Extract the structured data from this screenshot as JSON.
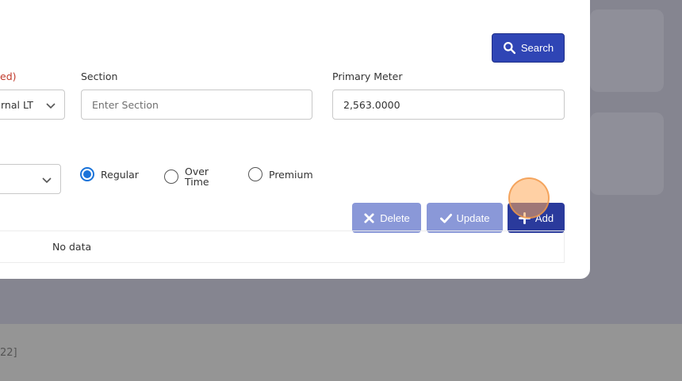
{
  "form": {
    "required_label_fragment": "ed)",
    "select_value_fragment": "rnal LT",
    "section_label": "Section",
    "section_placeholder": "Enter Section",
    "primary_meter_label": "Primary Meter",
    "primary_meter_value": "2,563.0000"
  },
  "toolbar": {
    "search_label": "Search",
    "delete_label": "Delete",
    "update_label": "Update",
    "add_label": "Add"
  },
  "shift_options": [
    {
      "label": "Regular",
      "selected": true
    },
    {
      "label_line1": "Over",
      "label_line2": "Time",
      "selected": false
    },
    {
      "label": "Premium",
      "selected": false
    }
  ],
  "table": {
    "empty_text": "No data"
  },
  "footer": {
    "text_fragment": "22]"
  },
  "colors": {
    "primary": "#2f45b5",
    "primary_disabled": "#8a98d8",
    "required_label": "#c0392b",
    "radio_selected": "#1a73d9",
    "overlay": "#858590"
  }
}
